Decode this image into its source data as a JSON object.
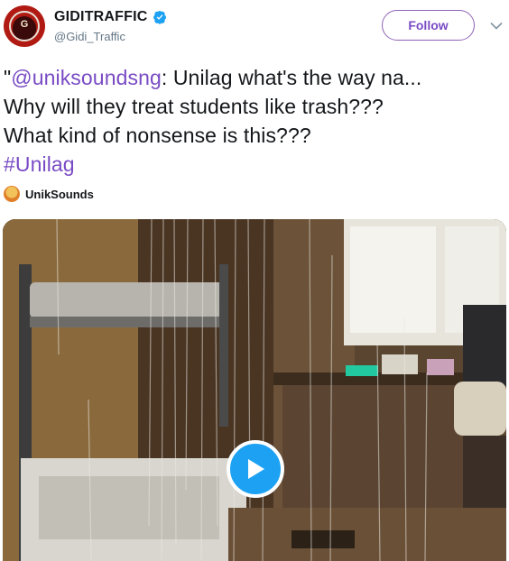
{
  "user": {
    "display_name": "GIDITRAFFIC",
    "handle": "@Gidi_Traffic",
    "avatar_glyph": "G",
    "verified_icon": "verified-badge-icon"
  },
  "actions": {
    "follow_label": "Follow",
    "more_icon": "chevron-down-icon"
  },
  "tweet": {
    "quote_open": "\"",
    "mention": "@uniksoundsng",
    "line1_rest": ": Unilag what's the way na...",
    "line2": "Why will they treat students like trash???",
    "line3": "What kind of nonsense is this???",
    "hashtag": "#Unilag"
  },
  "attribution": {
    "name": "UnikSounds"
  },
  "media": {
    "play_icon": "play-icon"
  },
  "colors": {
    "accent": "#794bc4",
    "verified": "#1da1f2",
    "play_button": "#1da1f2"
  }
}
